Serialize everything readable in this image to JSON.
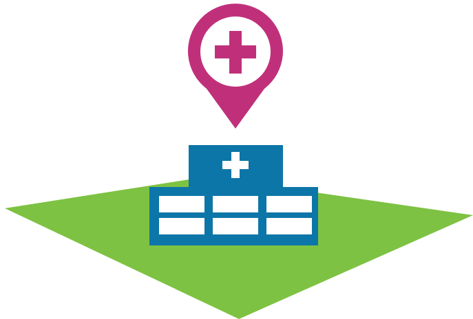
{
  "illustration": {
    "subject": "hospital-location",
    "icons": [
      "map-pin-icon",
      "medical-cross-icon",
      "hospital-building-icon",
      "ground-plane-icon"
    ]
  },
  "colors": {
    "background": "#ffffff",
    "ground": "#7dc242",
    "pin": "#c0307a",
    "pin_inner": "#ffffff",
    "building": "#0d76a8",
    "building_windows": "#ffffff",
    "cross": "#ffffff"
  },
  "building": {
    "window_rows": 2,
    "window_cols": 3
  }
}
